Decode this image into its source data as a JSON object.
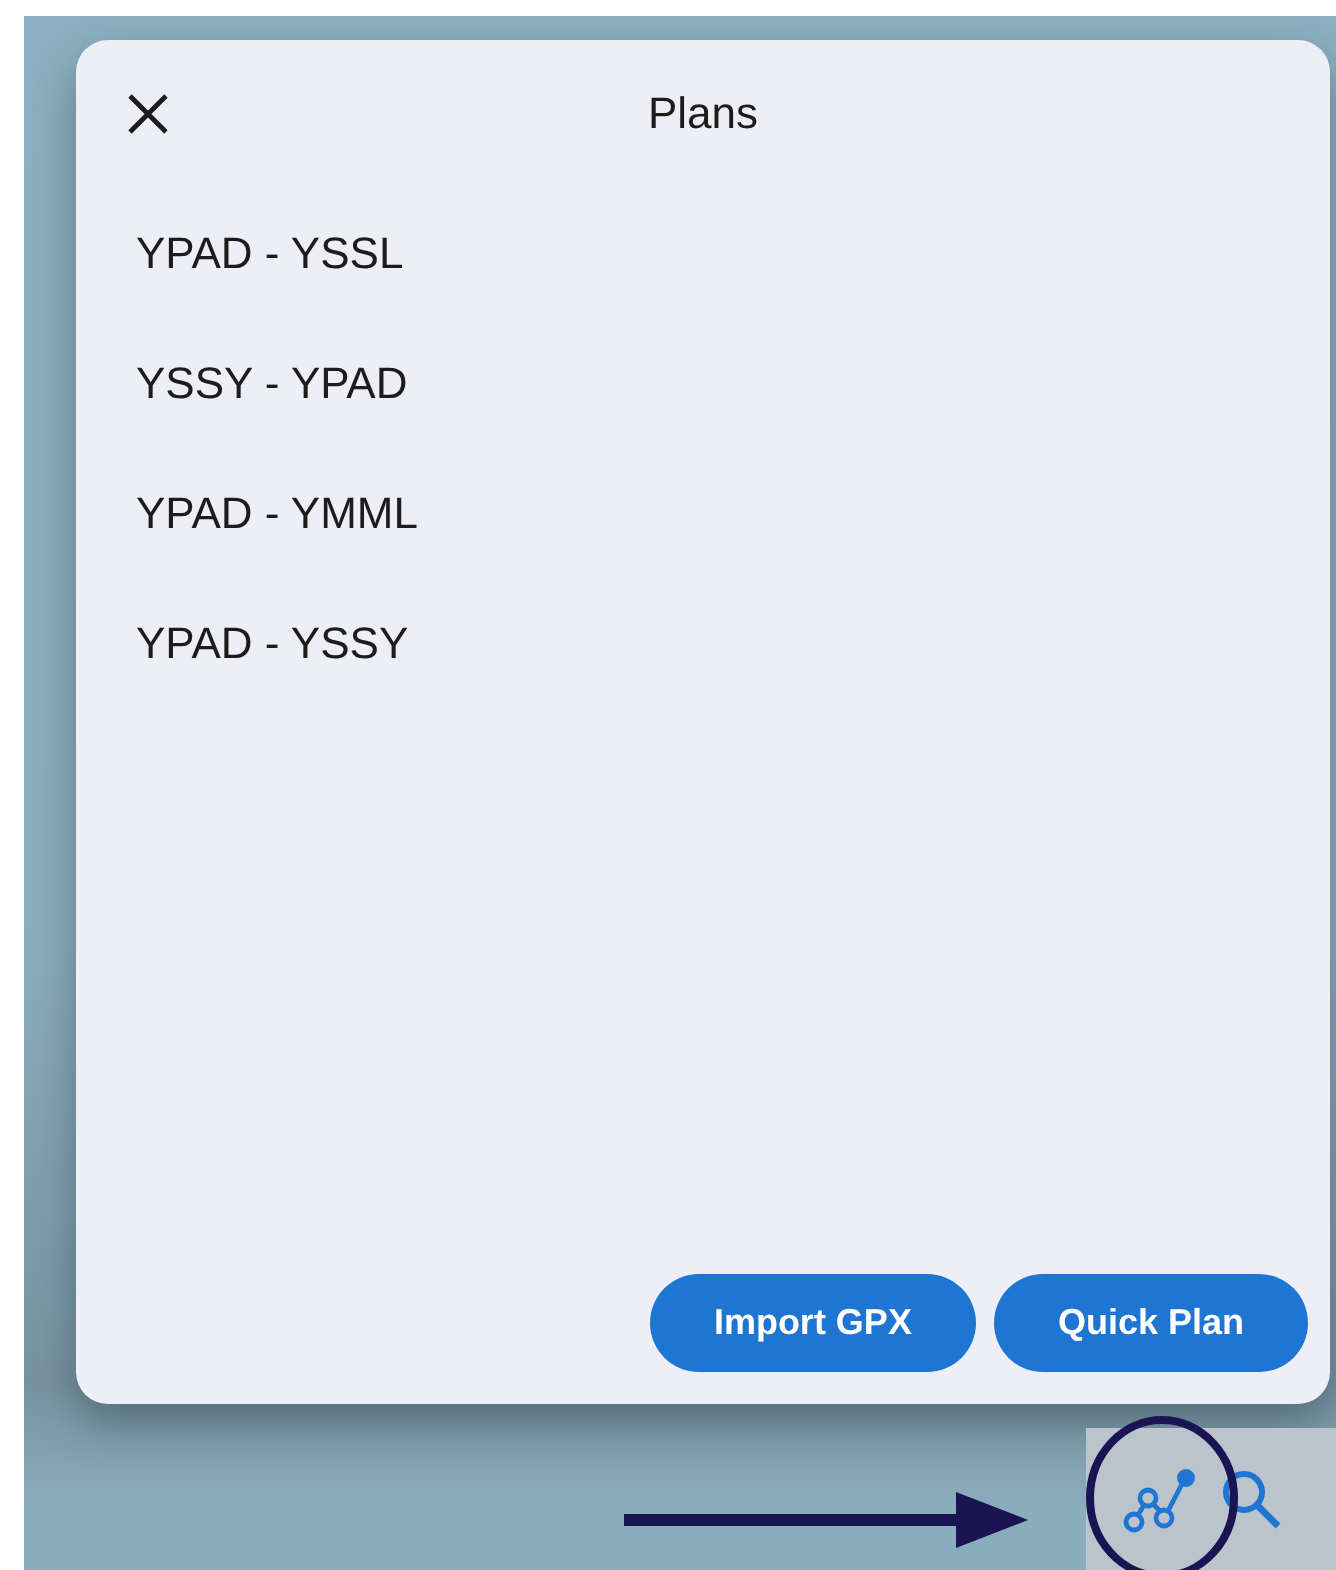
{
  "dialog": {
    "title": "Plans",
    "plans": [
      "YPAD - YSSL",
      "YSSY - YPAD",
      "YPAD - YMML",
      "YPAD - YSSY"
    ],
    "buttons": [
      "Import GPX",
      "Quick Plan"
    ]
  }
}
